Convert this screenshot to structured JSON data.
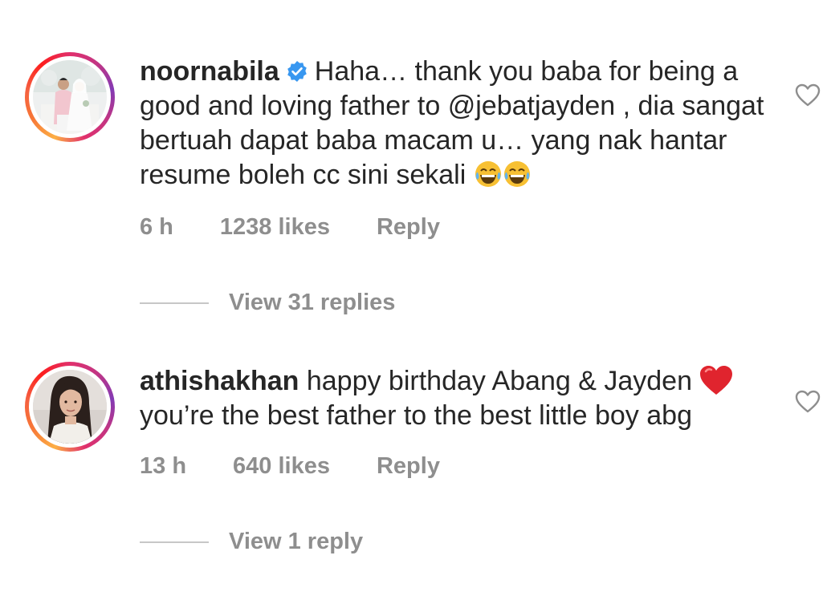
{
  "comments": [
    {
      "username": "noornabila",
      "verified": true,
      "text": "Haha… thank you baba for being a good and loving father to @jebatjayden , dia sangat bertuah dapat baba macam u… yang nak hantar resume boleh cc sini sekali",
      "trailing_emoji": [
        "tears-of-joy-emoji",
        "tears-of-joy-emoji"
      ],
      "time": "6 h",
      "likes": "1238 likes",
      "reply_label": "Reply",
      "view_replies": "View 31 replies"
    },
    {
      "username": "athishakhan",
      "verified": false,
      "text": "happy birthday Abang & Jayden",
      "trailing_emoji": [
        "red-heart-emoji"
      ],
      "text_after_emoji": "you’re the best father to the best little boy abg",
      "time": "13 h",
      "likes": "640 likes",
      "reply_label": "Reply",
      "view_replies": "View 1 reply"
    }
  ],
  "colors": {
    "text": "#262626",
    "secondary": "#8e8e8e",
    "verified_blue": "#3897f0",
    "heart_red": "#e0242e",
    "divider": "#c7c7c7"
  }
}
